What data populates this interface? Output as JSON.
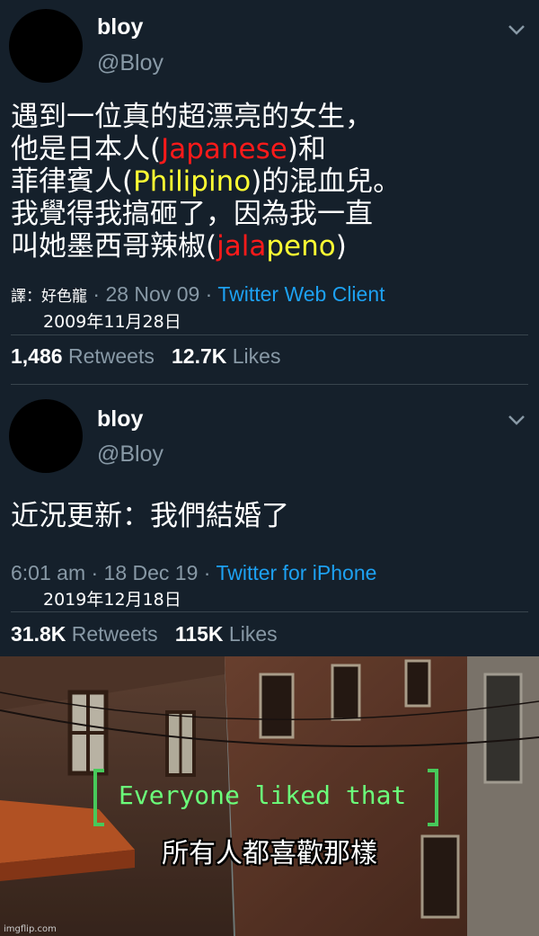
{
  "tweet1": {
    "name": "bloy",
    "handle": "@Bloy",
    "text": {
      "line1": "遇到一位真的超漂亮的女生，",
      "line2_pre": "他是日本人(",
      "line2_red": "Japanese",
      "line2_post": ")和",
      "line3_pre": "菲律賓人(",
      "line3_yellow": "Philipino",
      "line3_post": ")的混血兒。",
      "line4": "我覺得我搞砸了，因為我一直",
      "line5_pre": "叫她墨西哥辣椒(",
      "line5_red": "jala",
      "line5_yellow": "peno",
      "line5_post": ")"
    },
    "meta_overlay": "譯：好色龍",
    "meta_date": "· 28 Nov 09 ·",
    "client": "Twitter Web Client",
    "date_caption": "2009年11月28日",
    "retweets": "1,486",
    "retweets_label": "Retweets",
    "likes": "12.7K",
    "likes_label": "Likes"
  },
  "tweet2": {
    "name": "bloy",
    "handle": "@Bloy",
    "text": "近況更新：我們結婚了",
    "meta_time": "6:01 am · 18 Dec 19 ·",
    "client": "Twitter for iPhone",
    "date_caption": "2019年12月18日",
    "retweets": "31.8K",
    "retweets_label": "Retweets",
    "likes": "115K",
    "likes_label": "Likes"
  },
  "scene": {
    "game_text": "Everyone liked that",
    "caption": "所有人都喜歡那樣",
    "watermark": "imgflip.com"
  },
  "colors": {
    "background": "#15202b",
    "muted": "#8899a6",
    "link": "#1da1f2",
    "red": "#ff1a1a",
    "yellow": "#ffff33",
    "game_green": "#6bff7a"
  }
}
